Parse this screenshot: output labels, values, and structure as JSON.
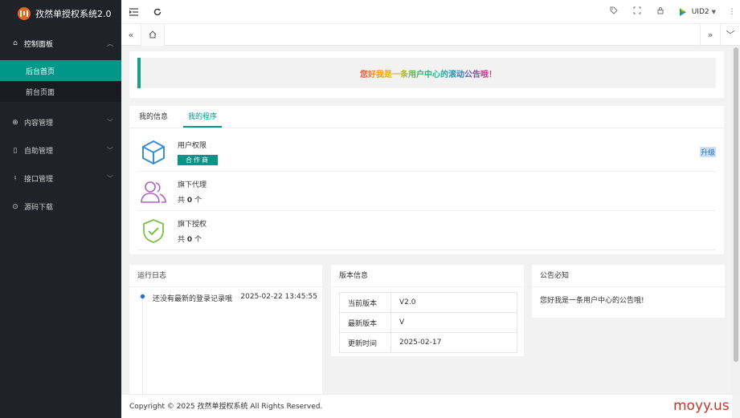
{
  "app": {
    "title": "孜然单授权系统2.0"
  },
  "sidebar": {
    "groups": [
      {
        "label": "控制面板",
        "icon": "home-icon",
        "expanded": true,
        "children": [
          {
            "label": "后台首页",
            "active": true
          },
          {
            "label": "前台页面",
            "active": false
          }
        ]
      },
      {
        "label": "内容管理",
        "icon": "globe-icon"
      },
      {
        "label": "自助管理",
        "icon": "book-icon"
      },
      {
        "label": "接口管理",
        "icon": "hand-icon"
      },
      {
        "label": "源码下载",
        "icon": "download-icon"
      }
    ]
  },
  "header": {
    "user_name": "UID2"
  },
  "notice": {
    "text": "您好我是一条用户中心的滚动公告哦！"
  },
  "program_card": {
    "tabs": [
      {
        "label": "我的信息"
      },
      {
        "label": "我的程序",
        "active": true
      }
    ],
    "rows": [
      {
        "title": "用户权限",
        "badge": "合作商",
        "action": "升级"
      },
      {
        "title": "旗下代理",
        "count_prefix": "共",
        "count": "0",
        "count_suffix": "个"
      },
      {
        "title": "旗下授权",
        "count_prefix": "共",
        "count": "0",
        "count_suffix": "个"
      }
    ]
  },
  "log_card": {
    "title": "运行日志",
    "entries": [
      {
        "text": "还没有最新的登录记录哦",
        "time": "2025-02-22 13:45:55"
      }
    ]
  },
  "version_card": {
    "title": "版本信息",
    "rows": [
      {
        "label": "当前版本",
        "value": "V2.0"
      },
      {
        "label": "最新版本",
        "value": "V"
      },
      {
        "label": "更新时间",
        "value": "2025-02-17"
      }
    ]
  },
  "announcement_card": {
    "title": "公告必知",
    "text": "您好我是一条用户中心的公告哦!"
  },
  "footer": {
    "text": "Copyright © 2025 孜然单授权系统 All Rights Reserved."
  },
  "watermark": {
    "text": "moyy.us"
  },
  "colors": {
    "sidebar_bg": "#20222a",
    "accent": "#009688",
    "link": "#1e6bb8"
  }
}
